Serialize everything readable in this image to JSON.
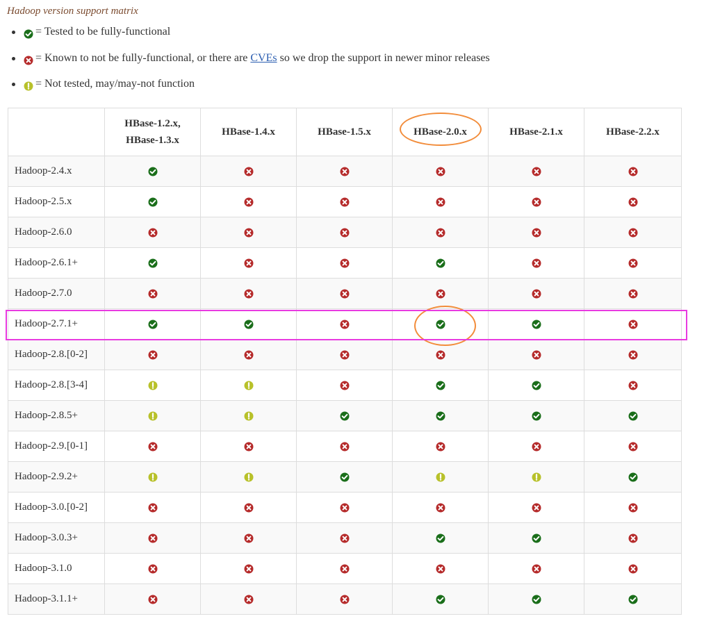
{
  "caption": "Hadoop version support matrix",
  "legend": {
    "tested": {
      "icon": "check-icon",
      "text": "= Tested to be fully-functional"
    },
    "not_functional": {
      "icon": "cross-icon",
      "text_before": "= Known to not be fully-functional, or there are ",
      "link": "CVEs",
      "text_after": " so we drop the support in newer minor releases"
    },
    "not_tested": {
      "icon": "exclaim-icon",
      "text": "= Not tested, may/may-not function"
    }
  },
  "colors": {
    "check": "#1a6e1a",
    "cross": "#b52a2a",
    "exclaim": "#b8c12a",
    "highlight_circle": "#f28c3a",
    "highlight_row": "#e83be0"
  },
  "table": {
    "corner": "",
    "columns": [
      [
        "HBase-1.2.x,",
        "HBase-1.3.x"
      ],
      [
        "HBase-1.4.x"
      ],
      [
        "HBase-1.5.x"
      ],
      [
        "HBase-2.0.x"
      ],
      [
        "HBase-2.1.x"
      ],
      [
        "HBase-2.2.x"
      ]
    ],
    "rows": [
      {
        "label": "Hadoop-2.4.x",
        "cells": [
          "check",
          "cross",
          "cross",
          "cross",
          "cross",
          "cross"
        ]
      },
      {
        "label": "Hadoop-2.5.x",
        "cells": [
          "check",
          "cross",
          "cross",
          "cross",
          "cross",
          "cross"
        ]
      },
      {
        "label": "Hadoop-2.6.0",
        "cells": [
          "cross",
          "cross",
          "cross",
          "cross",
          "cross",
          "cross"
        ]
      },
      {
        "label": "Hadoop-2.6.1+",
        "cells": [
          "check",
          "cross",
          "cross",
          "check",
          "cross",
          "cross"
        ]
      },
      {
        "label": "Hadoop-2.7.0",
        "cells": [
          "cross",
          "cross",
          "cross",
          "cross",
          "cross",
          "cross"
        ]
      },
      {
        "label": "Hadoop-2.7.1+",
        "cells": [
          "check",
          "check",
          "cross",
          "check",
          "check",
          "cross"
        ]
      },
      {
        "label": "Hadoop-2.8.[0-2]",
        "cells": [
          "cross",
          "cross",
          "cross",
          "cross",
          "cross",
          "cross"
        ]
      },
      {
        "label": "Hadoop-2.8.[3-4]",
        "cells": [
          "exclaim",
          "exclaim",
          "cross",
          "check",
          "check",
          "cross"
        ]
      },
      {
        "label": "Hadoop-2.8.5+",
        "cells": [
          "exclaim",
          "exclaim",
          "check",
          "check",
          "check",
          "check"
        ]
      },
      {
        "label": "Hadoop-2.9.[0-1]",
        "cells": [
          "cross",
          "cross",
          "cross",
          "cross",
          "cross",
          "cross"
        ]
      },
      {
        "label": "Hadoop-2.9.2+",
        "cells": [
          "exclaim",
          "exclaim",
          "check",
          "exclaim",
          "exclaim",
          "check"
        ]
      },
      {
        "label": "Hadoop-3.0.[0-2]",
        "cells": [
          "cross",
          "cross",
          "cross",
          "cross",
          "cross",
          "cross"
        ]
      },
      {
        "label": "Hadoop-3.0.3+",
        "cells": [
          "cross",
          "cross",
          "cross",
          "check",
          "check",
          "cross"
        ]
      },
      {
        "label": "Hadoop-3.1.0",
        "cells": [
          "cross",
          "cross",
          "cross",
          "cross",
          "cross",
          "cross"
        ]
      },
      {
        "label": "Hadoop-3.1.1+",
        "cells": [
          "cross",
          "cross",
          "cross",
          "check",
          "check",
          "check"
        ]
      }
    ]
  },
  "annotations": {
    "highlighted_column": "HBase-2.0.x",
    "highlighted_row": "Hadoop-2.7.1+"
  }
}
